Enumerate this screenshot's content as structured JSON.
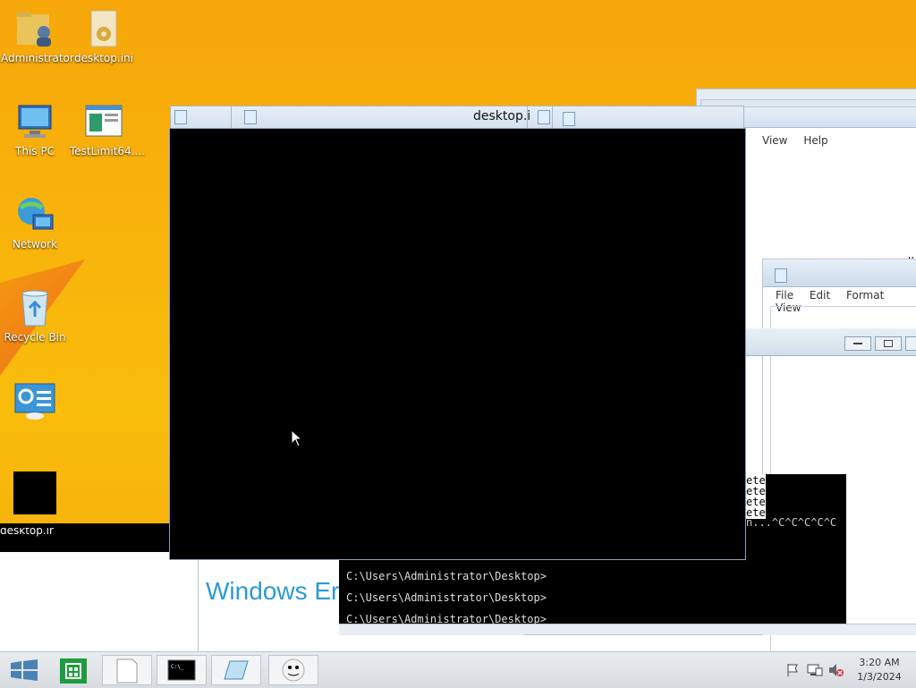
{
  "desktop": {
    "icons": [
      {
        "label": "Administrator",
        "icon": "user-folder-icon"
      },
      {
        "label": "desktop.ini",
        "icon": "settings-file-icon"
      },
      {
        "label": "This PC",
        "icon": "computer-icon"
      },
      {
        "label": "TestLimit64....",
        "icon": "application-icon"
      },
      {
        "label": "Network",
        "icon": "network-icon"
      },
      {
        "label": "Recycle Bin",
        "icon": "recycle-bin-icon"
      },
      {
        "label": "",
        "icon": "control-panel-icon"
      },
      {
        "label": "desktop.ini",
        "icon": "black-thumbnail-icon"
      }
    ]
  },
  "windows": {
    "front_titles": [
      "desktop.i"
    ],
    "notepad_menu": [
      "File",
      "Edit",
      "Format",
      "View"
    ],
    "back_menu": [
      "View",
      "Help"
    ],
    "partial_text": "cel'",
    "cmd_lines": [
      "C:\\Users\\Administrator\\Desktop>",
      "C:\\Users\\Administrator\\Desktop>",
      "C:\\Users\\Administrator\\Desktop>"
    ],
    "cmd_partial": [
      "ete",
      "ete",
      "ete",
      "ete",
      "n...^C^C^C^C^C"
    ],
    "banner_text": "Windows Er"
  },
  "taskbar": {
    "items": [
      "start-icon",
      "store-icon",
      "notepad-icon",
      "cmd-icon",
      "notepad-icon-2",
      "ghost-app-icon"
    ],
    "clock_time": "3:20 AM",
    "clock_date": "1/3/2024"
  },
  "colors": {
    "wallpaper": "#f6b30a",
    "accent": "#2a8ad6",
    "cmd_bg": "#000000"
  }
}
